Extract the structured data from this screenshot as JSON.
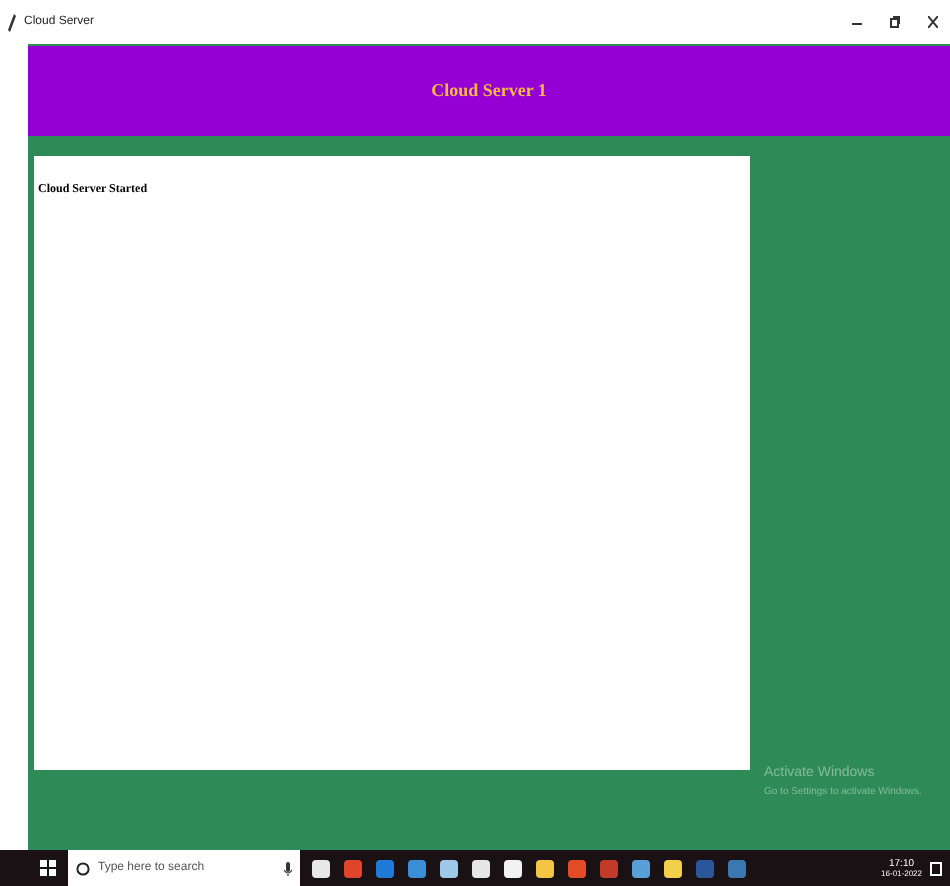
{
  "window": {
    "title": "Cloud Server"
  },
  "header": {
    "title": "Cloud Server 1"
  },
  "log": {
    "text": "Cloud Server Started"
  },
  "watermark_os": {
    "title": "Activate Windows",
    "subtitle": "Go to Settings to activate Windows."
  },
  "taskbar": {
    "search": {
      "placeholder": "Type here to search"
    },
    "time": "17:10",
    "date": "16-01-2022"
  }
}
